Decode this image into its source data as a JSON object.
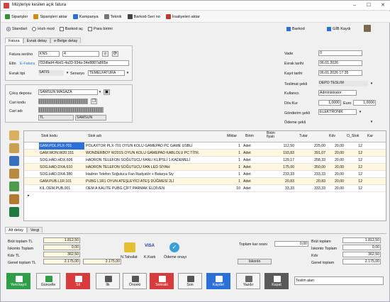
{
  "window": {
    "title": "Müşteriye kesilen açık fatura"
  },
  "menu": {
    "items": [
      {
        "label": "Siparişler",
        "icon": "orders-icon",
        "color": "#3a8f3a"
      },
      {
        "label": "Siparişleri aktar",
        "icon": "transfer-icon",
        "color": "#d08a1a"
      },
      {
        "label": "Kampanya",
        "icon": "campaign-icon",
        "color": "#2b6fd8"
      },
      {
        "label": "Teknik",
        "icon": "technical-icon",
        "color": "#777777"
      },
      {
        "label": "Barkod-Seri no",
        "icon": "barcode-icon",
        "color": "#444444"
      },
      {
        "label": "İrsaliyeleri aktar",
        "icon": "waybill-icon",
        "color": "#c0392b"
      }
    ]
  },
  "options": {
    "standart": "Standart",
    "hizli_mod": "Hızlı mod",
    "barkod_ac": "Barkod aç",
    "para_birimi": "Para birimi",
    "barkod": "Barkod",
    "gib_kaydi": "GİB Kaydı"
  },
  "tabs": [
    "Fatura",
    "Evrak detay",
    "e-Belge detay"
  ],
  "form": {
    "fatura_seri_no_label": "Fatura seri/no",
    "seri": "KNS",
    "no": "4",
    "ettn_label": "Ettn",
    "ettn_link": "E-Fatura",
    "ettn_value": "f32dfad4-4bd1-4a33-934a-34e8887a865e",
    "evrak_tipi_label": "Evrak tipi",
    "evrak_tipi": "SATIS",
    "senaryo_label": "Senaryo",
    "senaryo": "TEMELFATURA",
    "cikis_deposu_label": "Çıkış deposu",
    "cikis_deposu": "SAMSUN MAĞAZA",
    "cari_kodu_label": "Cari kodu",
    "cari_adi_label": "Cari adı",
    "il": "TL",
    "ilce": "SAMSUN"
  },
  "right_form": {
    "vade_label": "Vade",
    "vade": "0",
    "evrak_tarihi_label": "Evrak tarihi",
    "evrak_tarihi": "06.01.2026",
    "kayit_tarihi_label": "Kayıt tarihi",
    "kayit_tarihi": "06.01.2026 17:35",
    "teslimat_sekli_label": "Teslimat şekli",
    "teslimat_sekli": "DEPO TESLİM",
    "kullanici_label": "Kullanıcı",
    "kullanici": "Administrator",
    "doviz_label": "Döv.Kur",
    "doviz": "1,0000",
    "euro_label": "Euro",
    "euro": "1,0000",
    "gonderim_label": "Gönderim şekli",
    "gonderim": "ELEKTRONİK",
    "odeme_label": "Ödeme şekli"
  },
  "grid": {
    "headers": [
      "Stok kodu",
      "Stok adı",
      "Miktar",
      "Birim",
      "Birim fiyatı",
      "Tutar",
      "Kdv",
      "O_Stok",
      "Kar"
    ],
    "rows": [
      {
        "code": "GAM.POL.PLX-701",
        "name": "POLAXTOR PLX-701 OYUN KOLU GAMEPAD PC GAME USBLİ",
        "qty": "1",
        "unit": "Adet",
        "price": "112,50",
        "total": "225,00",
        "kdv": "20,00",
        "stock": "12"
      },
      {
        "code": "GAM.WON.W20.151",
        "name": "WONDERBOY W201S OYUN KOLU GAMEPAD KABLOLU PC TİTR.",
        "qty": "1",
        "unit": "Adet",
        "price": "193,83",
        "total": "391,07",
        "kdv": "20,00",
        "stock": "12"
      },
      {
        "code": "SOG.HAD.HDX.606",
        "name": "HADRON TELEFON SOĞUTUCU FANLI KLİPSLİ 1 KADEMELİ",
        "qty": "1",
        "unit": "Adet",
        "price": "129,17",
        "total": "258,33",
        "kdv": "20,00",
        "stock": "12"
      },
      {
        "code": "SOG.HAD.DXA.610",
        "name": "HADRON TELEFON SOĞUTUCU FAN LED SİYAH",
        "qty": "1",
        "unit": "Adet",
        "price": "175,00",
        "total": "350,00",
        "kdv": "20,00",
        "stock": "12"
      },
      {
        "code": "SOG.HAD.DXA.380",
        "name": "Hadron Telefon Soğutucu Fan Radyatör + Batarya Siy",
        "qty": "1",
        "unit": "Adet",
        "price": "233,33",
        "total": "233,33",
        "kdv": "20,00",
        "stock": "12"
      },
      {
        "code": "GAM.PUB.L1R.101",
        "name": "PUBG L1R1 OYUN ATEŞLEYİCİ ATEŞ DÜĞMESİ 2Lİ",
        "qty": "1",
        "unit": "Adet",
        "price": "20,83",
        "total": "20,83",
        "kdv": "20,00",
        "stock": "12"
      },
      {
        "code": "KIL.OEM.PUB.001",
        "name": "OEM A KALİTE PUBG ÇİFT PARMAK ELDİVEN",
        "qty": "10",
        "unit": "Adet",
        "price": "33,33",
        "total": "333,33",
        "kdv": "20,00",
        "stock": "12"
      }
    ]
  },
  "bottom_tabs": [
    "Alt detay",
    "Vergi"
  ],
  "totals": {
    "brut_label": "Brüt toplam TL",
    "brut": "1.812,50",
    "iskonto_label": "İskonto Toplam",
    "iskonto": "0,00",
    "kdv_label": "Kdv TL",
    "kdv": "362,50",
    "genel_label": "Genel toplam TL",
    "genel": "2.175,00",
    "genel2": "2.175,00",
    "top_kar_label": "Toplam kar oranı",
    "top_kar": "0,00",
    "iskonto_btn": "İskonto",
    "r_brut_label": "Brüt toplam",
    "r_brut": "1.812,50",
    "r_iskonto_label": "İskonto Toplam",
    "r_iskonto": "0,00",
    "r_kdv_label": "Kdv",
    "r_kdv": "362,50",
    "r_genel_label": "Genel toplam",
    "r_genel": "2.175,00"
  },
  "payments": {
    "nakit": "N.Tahsilat",
    "kart": "K.Kartı",
    "odeme": "Ödeme onayı",
    "visa": "VISA"
  },
  "buttons": {
    "yeni": "Yeni kayıt",
    "guncelle": "Güncelle",
    "sil": "Sil",
    "ilk": "İlk",
    "onceki": "Önceki",
    "sonraki": "Sonraki",
    "son": "Son",
    "kaydet": "Kaydet",
    "yazdir": "Yazdır",
    "kapat": "Kapat",
    "teslim_alan": "Teslim alan"
  }
}
